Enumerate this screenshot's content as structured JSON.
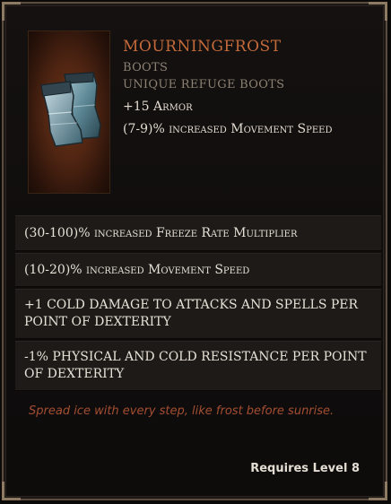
{
  "item": {
    "name": "MOURNINGFROST",
    "type": "BOOTS",
    "subtype": "UNIQUE REFUGE BOOTS",
    "implicits": [
      "+15 Armor",
      "(7-9)% increased Movement Speed"
    ]
  },
  "affixes": [
    "(30-100)% increased Freeze Rate Multiplier",
    "(10-20)% increased Movement Speed",
    "+1 COLD DAMAGE TO ATTACKS AND SPELLS PER POINT OF DEXTERITY",
    "-1% PHYSICAL AND COLD RESISTANCE PER POINT OF DEXTERITY"
  ],
  "flavor": "Spread ice with every step, like frost before sunrise.",
  "requirement": "Requires Level 8",
  "colors": {
    "name": "#c46a3a",
    "flavor": "#a44e32",
    "border": "#5a4d40",
    "portrait": "#4e2412"
  },
  "icons": {
    "portrait": "ice-boots-icon"
  }
}
